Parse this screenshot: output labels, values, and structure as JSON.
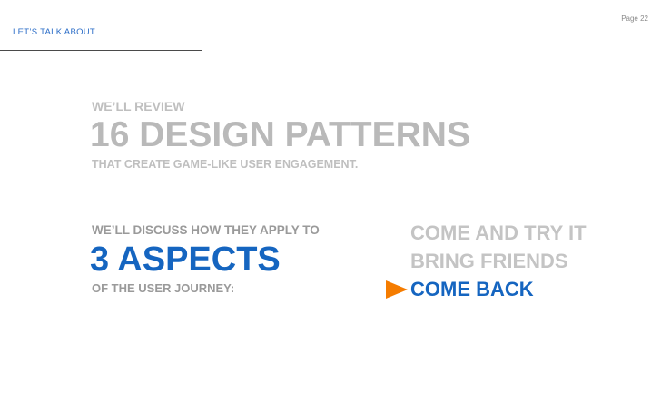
{
  "header": {
    "section_label": "LET’S TALK ABOUT…",
    "page_number": "Page 22"
  },
  "review": {
    "intro": "WE’LL REVIEW",
    "headline": "16 DESIGN PATTERNS",
    "subline": "THAT CREATE GAME-LIKE USER ENGAGEMENT."
  },
  "discussion": {
    "intro": "WE’LL DISCUSS HOW THEY APPLY TO",
    "headline": "3 ASPECTS",
    "subline": "OF THE USER JOURNEY:"
  },
  "journey": {
    "items": [
      {
        "label": "COME AND TRY IT",
        "active": false
      },
      {
        "label": "BRING FRIENDS",
        "active": false
      },
      {
        "label": "COME BACK",
        "active": true
      }
    ],
    "marker_icon": "arrow-right-icon"
  },
  "colors": {
    "accent_blue": "#1565c0",
    "label_blue": "#2a6cc7",
    "marker_orange": "#f57c00",
    "muted_gray": "#bfbfbf",
    "text_gray": "#9a9a9a"
  }
}
